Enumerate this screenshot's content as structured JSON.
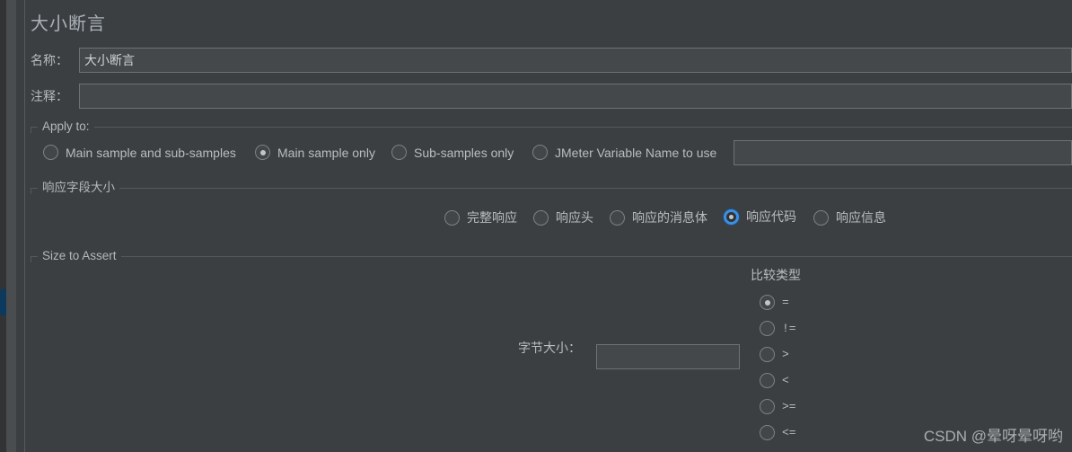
{
  "window": {
    "title": "大小断言"
  },
  "fields": {
    "name_label": "名称：",
    "name_value": "大小断言",
    "comment_label": "注释：",
    "comment_value": ""
  },
  "apply_to": {
    "legend": "Apply to:",
    "options": [
      {
        "label": "Main sample and sub-samples",
        "selected": false
      },
      {
        "label": "Main sample only",
        "selected": true
      },
      {
        "label": "Sub-samples only",
        "selected": false
      },
      {
        "label": "JMeter Variable Name to use",
        "selected": false
      }
    ],
    "variable_value": ""
  },
  "response_field": {
    "legend": "响应字段大小",
    "options": [
      {
        "label": "完整响应",
        "selected": false
      },
      {
        "label": "响应头",
        "selected": false
      },
      {
        "label": "响应的消息体",
        "selected": false
      },
      {
        "label": "响应代码",
        "selected": true
      },
      {
        "label": "响应信息",
        "selected": false
      }
    ]
  },
  "size_to_assert": {
    "legend": "Size to Assert",
    "byte_size_label": "字节大小：",
    "byte_size_value": "",
    "comparison_title": "比较类型",
    "comparison_options": [
      {
        "label": "=",
        "selected": true
      },
      {
        "label": "!=",
        "selected": false
      },
      {
        "label": ">",
        "selected": false
      },
      {
        "label": "<",
        "selected": false
      },
      {
        "label": ">=",
        "selected": false
      },
      {
        "label": "<=",
        "selected": false
      }
    ]
  },
  "watermark": {
    "text": "CSDN @晕呀晕呀哟"
  },
  "colors": {
    "background": "#3c3f41",
    "input_fill": "#45484a",
    "input_border": "#6f7274",
    "text": "#b9bdc0",
    "accent_focus": "#3f8ee0",
    "rail_selection": "#0d3a5c"
  }
}
